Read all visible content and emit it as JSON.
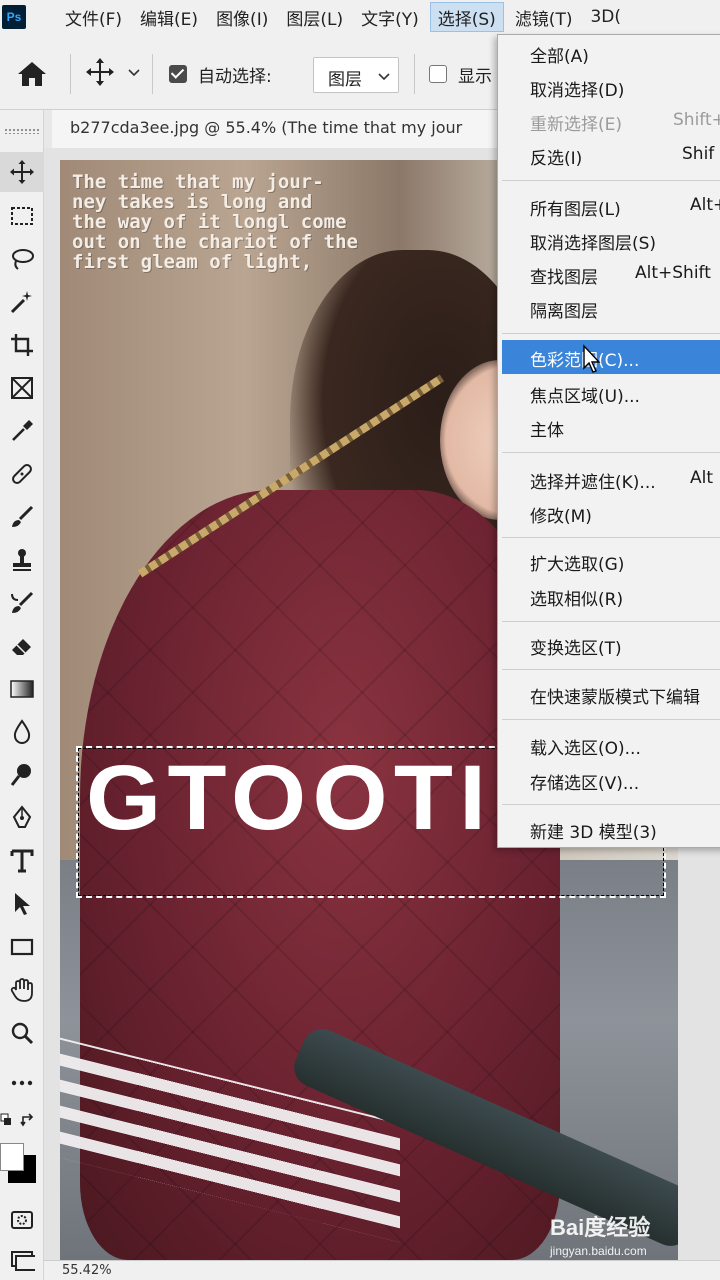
{
  "app": {
    "logo": "Ps"
  },
  "menubar": {
    "items": [
      {
        "label": "文件(F)"
      },
      {
        "label": "编辑(E)"
      },
      {
        "label": "图像(I)"
      },
      {
        "label": "图层(L)"
      },
      {
        "label": "文字(Y)"
      },
      {
        "label": "选择(S)",
        "active": true
      },
      {
        "label": "滤镜(T)"
      },
      {
        "label": "3D("
      }
    ]
  },
  "options": {
    "auto_select_label": "自动选择:",
    "auto_select_checked": true,
    "layer_select_value": "图层",
    "show_label": "显示",
    "show_checked": false
  },
  "document": {
    "tab_title": "b277cda3ee.jpg @ 55.4% (The time that my jour",
    "zoom_status": "55.42%"
  },
  "image_content": {
    "poster_text": "The time that my jour-\nney takes is long and\nthe way of it longl come\nout on the chariot of the\nfirst gleam of light,",
    "big_text": "GTOOTI",
    "watermark_main": "Bai度经验",
    "watermark_sub": "jingyan.baidu.com"
  },
  "select_menu": {
    "items": [
      {
        "label": "全部(A)",
        "shortcut": "",
        "disabled": false
      },
      {
        "label": "取消选择(D)",
        "shortcut": "",
        "disabled": false
      },
      {
        "label": "重新选择(E)",
        "shortcut": "Shift+",
        "disabled": true
      },
      {
        "label": "反选(I)",
        "shortcut": "Shif",
        "disabled": false
      },
      {
        "label": "所有图层(L)",
        "shortcut": "Alt+",
        "disabled": false
      },
      {
        "label": "取消选择图层(S)",
        "shortcut": "",
        "disabled": false
      },
      {
        "label": "查找图层",
        "shortcut": "Alt+Shift",
        "disabled": false
      },
      {
        "label": "隔离图层",
        "shortcut": "",
        "disabled": false
      },
      {
        "label": "色彩范围(C)...",
        "shortcut": "",
        "disabled": false,
        "highlighted": true
      },
      {
        "label": "焦点区域(U)...",
        "shortcut": "",
        "disabled": false
      },
      {
        "label": "主体",
        "shortcut": "",
        "disabled": false
      },
      {
        "label": "选择并遮住(K)...",
        "shortcut": "Alt",
        "disabled": false
      },
      {
        "label": "修改(M)",
        "shortcut": "",
        "disabled": false
      },
      {
        "label": "扩大选取(G)",
        "shortcut": "",
        "disabled": false
      },
      {
        "label": "选取相似(R)",
        "shortcut": "",
        "disabled": false
      },
      {
        "label": "变换选区(T)",
        "shortcut": "",
        "disabled": false
      },
      {
        "label": "在快速蒙版模式下编辑",
        "shortcut": "",
        "disabled": false
      },
      {
        "label": "载入选区(O)...",
        "shortcut": "",
        "disabled": false
      },
      {
        "label": "存储选区(V)...",
        "shortcut": "",
        "disabled": false
      },
      {
        "label": "新建 3D 模型(3)",
        "shortcut": "",
        "disabled": false
      }
    ]
  },
  "colors": {
    "highlight": "#3a84d9",
    "menu_bg": "#f2f2f2",
    "ps_logo_bg": "#001e36",
    "ps_logo_fg": "#31a8ff"
  },
  "toolbar_icons": [
    "move-icon",
    "marquee-icon",
    "lasso-icon",
    "magic-wand-icon",
    "crop-icon",
    "frame-icon",
    "eyedropper-icon",
    "healing-brush-icon",
    "brush-icon",
    "stamp-icon",
    "history-brush-icon",
    "eraser-icon",
    "gradient-icon",
    "blur-icon",
    "dodge-icon",
    "pen-icon",
    "type-icon",
    "path-select-icon",
    "rectangle-icon",
    "hand-icon",
    "zoom-icon",
    "more-tools-icon",
    "color-swatches",
    "quick-mask-icon",
    "screen-mode-icon"
  ]
}
